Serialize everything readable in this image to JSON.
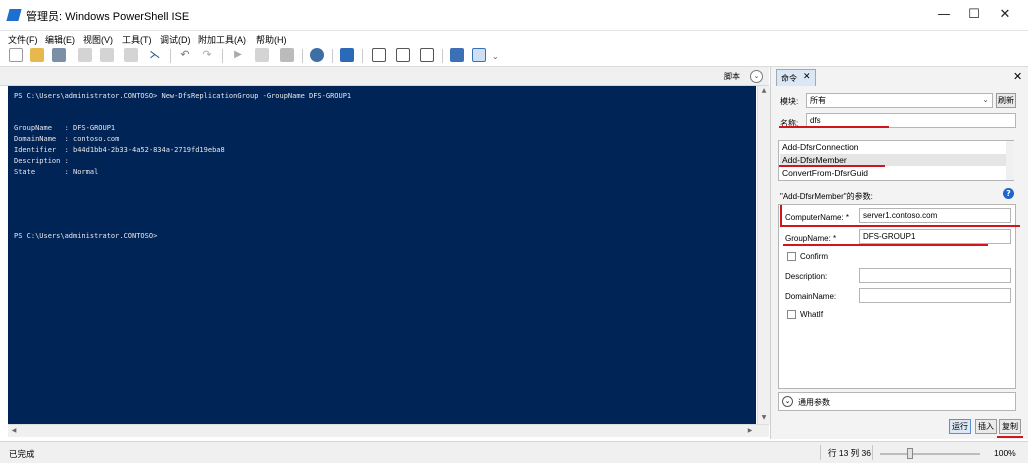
{
  "window": {
    "title": "管理员: Windows PowerShell ISE",
    "minimize": "—",
    "maximize": "☐",
    "close": "✕"
  },
  "menu": [
    "文件(F)",
    "编辑(E)",
    "视图(V)",
    "工具(T)",
    "调试(D)",
    "附加工具(A)",
    "帮助(H)"
  ],
  "toolbar": {
    "icons": [
      "new-file-icon",
      "open-folder-icon",
      "save-icon",
      "cut-icon",
      "copy-icon",
      "paste-icon",
      "clear-console-icon",
      "undo-icon",
      "redo-icon",
      "run-icon",
      "run-selection-icon",
      "stop-icon",
      "remote-powershell-icon",
      "powershell-icon",
      "layout-top-icon",
      "layout-right-icon",
      "layout-max-icon",
      "show-commands-icon",
      "show-addon-icon"
    ]
  },
  "script_pane": {
    "label": "脚本",
    "collapse_glyph": "⌄"
  },
  "console": {
    "lines": [
      "PS C:\\Users\\administrator.CONTOSO> New-DfsReplicationGroup -GroupName DFS-GROUP1",
      "",
      "",
      "GroupName   : DFS-GROUP1",
      "DomainName  : contoso.com",
      "Identifier  : b44d1bb4-2b33-4a52-834a-2719fd19eba8",
      "Description :",
      "State       : Normal",
      "",
      "",
      "",
      "",
      "",
      "PS C:\\Users\\administrator.CONTOSO>"
    ]
  },
  "commands_pane": {
    "tab_label": "命令",
    "tab_close": "✕",
    "pane_close": "✕",
    "module_label": "模块:",
    "module_value": "所有",
    "refresh_button": "刷新",
    "name_label": "名称:",
    "name_value": "dfs",
    "command_list": [
      "Add-DfsrConnection",
      "Add-DfsrMember",
      "ConvertFrom-DfsrGuid"
    ],
    "selected_command": "Add-DfsrMember",
    "params_title": "\"Add-DfsrMember\"的参数:",
    "help_glyph": "?",
    "params": {
      "computer_name_label": "ComputerName: *",
      "computer_name_value": "server1.contoso.com",
      "group_name_label": "GroupName: *",
      "group_name_value": "DFS-GROUP1",
      "confirm_label": "Confirm",
      "description_label": "Description:",
      "domain_name_label": "DomainName:",
      "whatif_label": "WhatIf"
    },
    "common_params_label": "通用参数",
    "run_button": "运行",
    "insert_button": "插入",
    "copy_button": "复制"
  },
  "status": {
    "text": "已完成",
    "position": "行 13 列 36",
    "zoom": 1.0,
    "zoom_label": "100%"
  },
  "colors": {
    "console_bg": "#012456",
    "highlight_red": "#d0161c"
  }
}
